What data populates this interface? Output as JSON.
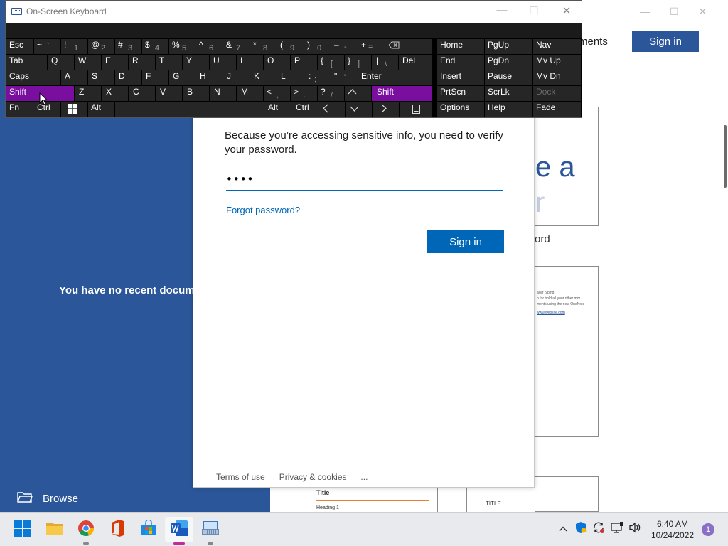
{
  "word": {
    "recent_message": "You have no recent docume",
    "browse_label": "Browse",
    "documents_label": "ments",
    "signin_label": "Sign in",
    "template_label": "ord",
    "blank_text_1": "e a",
    "blank_text_2": "r",
    "tour_lines": [
      "alter typing",
      "o for bold all your other mor",
      "ments using the new OneNote"
    ],
    "tour_link": "www.website.com",
    "tpl_a_title": "Title",
    "tpl_a_heading": "Heading 1",
    "tpl_b_small": "TITLE"
  },
  "dialog": {
    "message": "Because you’re accessing sensitive info, you need to verify your password.",
    "password_value": "••••",
    "forgot_link": "Forgot password?",
    "signin_button": "Sign in",
    "footer": {
      "terms": "Terms of use",
      "privacy": "Privacy & cookies",
      "more": "..."
    }
  },
  "osk": {
    "title": "On-Screen Keyboard",
    "window_controls": {
      "minimize": "—",
      "maximize": "☐",
      "close": "✕"
    },
    "keys": {
      "esc": "Esc",
      "tilde": "~",
      "tilde_sub": "`",
      "n1": "!",
      "n1s": "1",
      "n2": "@",
      "n2s": "2",
      "n3": "#",
      "n3s": "3",
      "n4": "$",
      "n4s": "4",
      "n5": "%",
      "n5s": "5",
      "n6": "^",
      "n6s": "6",
      "n7": "&",
      "n7s": "7",
      "n8": "*",
      "n8s": "8",
      "n9": "(",
      "n9s": "9",
      "n0": ")",
      "n0s": "0",
      "minus": "–",
      "minus_s": "-",
      "plus": "+",
      "plus_s": "=",
      "home": "Home",
      "pgup": "PgUp",
      "nav": "Nav",
      "tab": "Tab",
      "q": "Q",
      "w": "W",
      "e": "E",
      "r": "R",
      "t": "T",
      "y": "Y",
      "u": "U",
      "i": "I",
      "o": "O",
      "p": "P",
      "lbrace": "{",
      "lbrace_s": "[",
      "rbrace": "}",
      "rbrace_s": "]",
      "pipe": "|",
      "pipe_s": "\\",
      "del": "Del",
      "end": "End",
      "pgdn": "PgDn",
      "mvup": "Mv Up",
      "caps": "Caps",
      "a": "A",
      "s": "S",
      "d": "D",
      "f": "F",
      "g": "G",
      "h": "H",
      "j": "J",
      "k": "K",
      "l": "L",
      "colon": ":",
      "colon_s": ";",
      "quote": "\"",
      "quote_s": "'",
      "enter": "Enter",
      "insert": "Insert",
      "pause": "Pause",
      "mvdn": "Mv Dn",
      "shift_l": "Shift",
      "z": "Z",
      "x": "X",
      "c": "C",
      "v": "V",
      "b": "B",
      "n": "N",
      "m": "M",
      "lt": "<",
      "lt_s": ",",
      "gt": ">",
      "gt_s": ".",
      "qmark": "?",
      "qmark_s": "/",
      "shift_r": "Shift",
      "prtscn": "PrtScn",
      "scrlk": "ScrLk",
      "dock": "Dock",
      "fn": "Fn",
      "ctrl_l": "Ctrl",
      "alt_l": "Alt",
      "alt_r": "Alt",
      "ctrl_r": "Ctrl",
      "options": "Options",
      "help": "Help",
      "fade": "Fade"
    }
  },
  "taskbar": {
    "time": "6:40 AM",
    "date": "10/24/2022",
    "notification_count": "1"
  },
  "colors": {
    "word_blue": "#2b579a",
    "ms_blue": "#0067b8",
    "osk_selected": "#7a0e9e",
    "taskbar": "#e9eaed"
  }
}
